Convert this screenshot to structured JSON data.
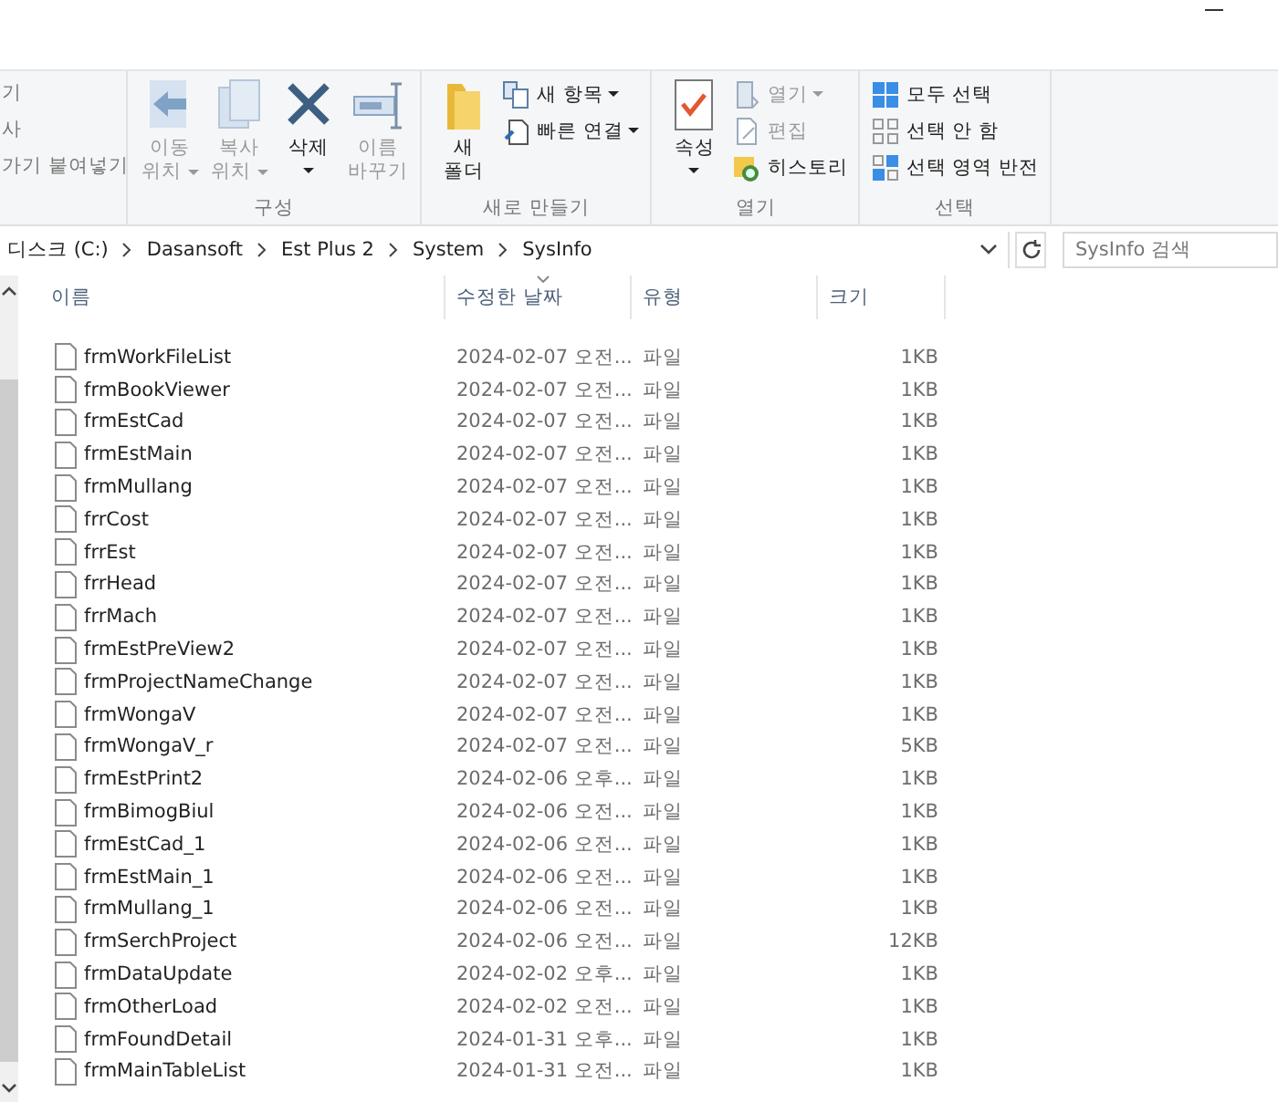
{
  "ribbon": {
    "clipboard_partial": [
      "기",
      "사",
      "가기 붙여넣기"
    ],
    "groups": [
      {
        "label": "구성",
        "items": [
          {
            "kind": "large",
            "lines": [
              "이동",
              "위치"
            ],
            "dropdown": true,
            "disabled": true
          },
          {
            "kind": "large",
            "lines": [
              "복사",
              "위치"
            ],
            "dropdown": true,
            "disabled": true
          },
          {
            "kind": "large",
            "lines": [
              "삭제"
            ],
            "dropdown": true,
            "disabled": false
          },
          {
            "kind": "large",
            "lines": [
              "이름",
              "바꾸기"
            ],
            "dropdown": false,
            "disabled": true
          }
        ]
      },
      {
        "label": "새로 만들기",
        "items": [
          {
            "kind": "large",
            "lines": [
              "새",
              "폴더"
            ],
            "dropdown": false,
            "disabled": false
          },
          {
            "kind": "small",
            "lines": [
              "새 항목"
            ],
            "dropdown": true,
            "disabled": false
          },
          {
            "kind": "small",
            "lines": [
              "빠른 연결"
            ],
            "dropdown": true,
            "disabled": false
          }
        ]
      },
      {
        "label": "열기",
        "items": [
          {
            "kind": "large",
            "lines": [
              "속성"
            ],
            "dropdown": true,
            "disabled": false
          },
          {
            "kind": "small",
            "lines": [
              "열기"
            ],
            "dropdown": true,
            "disabled": true
          },
          {
            "kind": "small",
            "lines": [
              "편집"
            ],
            "dropdown": false,
            "disabled": true
          },
          {
            "kind": "small",
            "lines": [
              "히스토리"
            ],
            "dropdown": false,
            "disabled": false
          }
        ]
      },
      {
        "label": "선택",
        "items": [
          {
            "kind": "small",
            "lines": [
              "모두 선택"
            ],
            "dropdown": false,
            "disabled": false
          },
          {
            "kind": "small",
            "lines": [
              "선택 안 함"
            ],
            "dropdown": false,
            "disabled": false
          },
          {
            "kind": "small",
            "lines": [
              "선택 영역 반전"
            ],
            "dropdown": false,
            "disabled": false
          }
        ]
      }
    ]
  },
  "address_bar": {
    "path": [
      "디스크 (C:)",
      "Dasansoft",
      "Est Plus 2",
      "System",
      "SysInfo"
    ]
  },
  "search": {
    "placeholder": "SysInfo 검색"
  },
  "columns": [
    {
      "label": "이름",
      "sorted": false
    },
    {
      "label": "수정한 날짜",
      "sorted": true
    },
    {
      "label": "유형",
      "sorted": false
    },
    {
      "label": "크기",
      "sorted": false
    }
  ],
  "files": [
    {
      "name": "frmWorkFileList",
      "modified": "2024-02-07 오전...",
      "type": "파일",
      "size": "1KB"
    },
    {
      "name": "frmBookViewer",
      "modified": "2024-02-07 오전...",
      "type": "파일",
      "size": "1KB"
    },
    {
      "name": "frmEstCad",
      "modified": "2024-02-07 오전...",
      "type": "파일",
      "size": "1KB"
    },
    {
      "name": "frmEstMain",
      "modified": "2024-02-07 오전...",
      "type": "파일",
      "size": "1KB"
    },
    {
      "name": "frmMullang",
      "modified": "2024-02-07 오전...",
      "type": "파일",
      "size": "1KB"
    },
    {
      "name": "frrCost",
      "modified": "2024-02-07 오전...",
      "type": "파일",
      "size": "1KB"
    },
    {
      "name": "frrEst",
      "modified": "2024-02-07 오전...",
      "type": "파일",
      "size": "1KB"
    },
    {
      "name": "frrHead",
      "modified": "2024-02-07 오전...",
      "type": "파일",
      "size": "1KB"
    },
    {
      "name": "frrMach",
      "modified": "2024-02-07 오전...",
      "type": "파일",
      "size": "1KB"
    },
    {
      "name": "frmEstPreView2",
      "modified": "2024-02-07 오전...",
      "type": "파일",
      "size": "1KB"
    },
    {
      "name": "frmProjectNameChange",
      "modified": "2024-02-07 오전...",
      "type": "파일",
      "size": "1KB"
    },
    {
      "name": "frmWongaV",
      "modified": "2024-02-07 오전...",
      "type": "파일",
      "size": "1KB"
    },
    {
      "name": "frmWongaV_r",
      "modified": "2024-02-07 오전...",
      "type": "파일",
      "size": "5KB"
    },
    {
      "name": "frmEstPrint2",
      "modified": "2024-02-06 오후...",
      "type": "파일",
      "size": "1KB"
    },
    {
      "name": "frmBimogBiul",
      "modified": "2024-02-06 오전...",
      "type": "파일",
      "size": "1KB"
    },
    {
      "name": "frmEstCad_1",
      "modified": "2024-02-06 오전...",
      "type": "파일",
      "size": "1KB"
    },
    {
      "name": "frmEstMain_1",
      "modified": "2024-02-06 오전...",
      "type": "파일",
      "size": "1KB"
    },
    {
      "name": "frmMullang_1",
      "modified": "2024-02-06 오전...",
      "type": "파일",
      "size": "1KB"
    },
    {
      "name": "frmSerchProject",
      "modified": "2024-02-06 오전...",
      "type": "파일",
      "size": "12KB"
    },
    {
      "name": "frmDataUpdate",
      "modified": "2024-02-02 오후...",
      "type": "파일",
      "size": "1KB"
    },
    {
      "name": "frmOtherLoad",
      "modified": "2024-02-02 오전...",
      "type": "파일",
      "size": "1KB"
    },
    {
      "name": "frmFoundDetail",
      "modified": "2024-01-31 오후...",
      "type": "파일",
      "size": "1KB"
    },
    {
      "name": "frmMainTableList",
      "modified": "2024-01-31 오전...",
      "type": "파일",
      "size": "1KB"
    }
  ]
}
